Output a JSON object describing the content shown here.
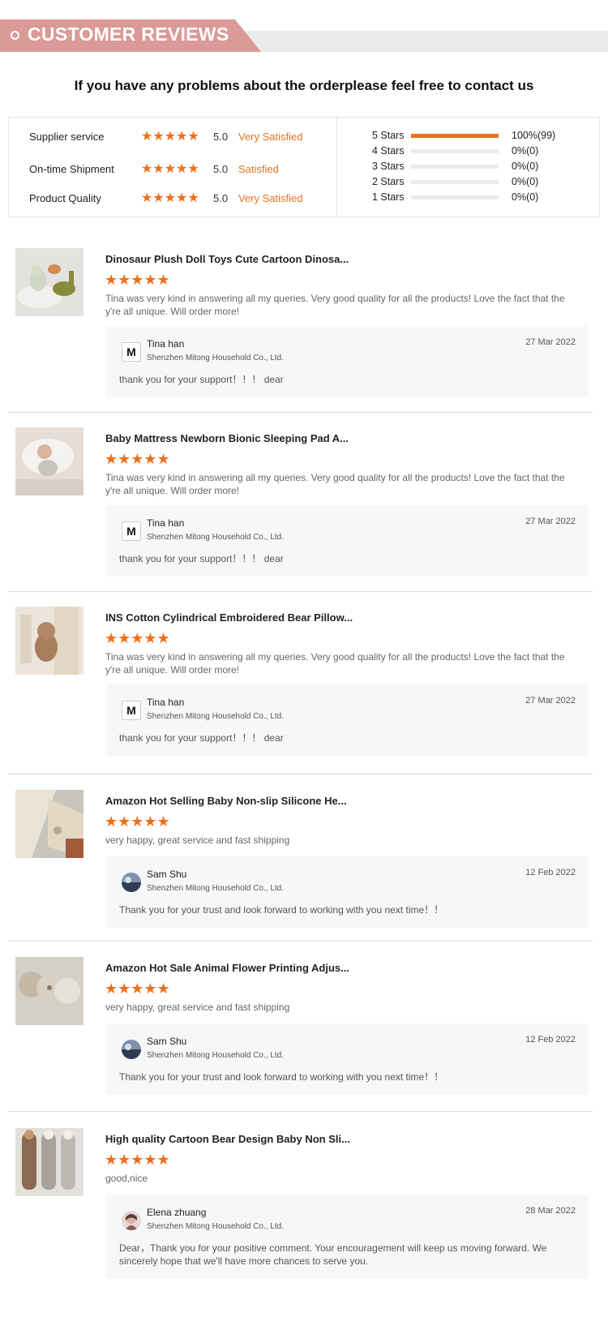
{
  "header": {
    "title": "CUSTOMER REVIEWS",
    "subtitle": "If you have any problems about the orderplease feel free to contact us"
  },
  "summary": {
    "metrics": [
      {
        "label": "Supplier service",
        "rating": 5,
        "score": "5.0",
        "text": "Very Satisfied"
      },
      {
        "label": "On-time Shipment",
        "rating": 5,
        "score": "5.0",
        "text": "Satisfied"
      },
      {
        "label": "Product Quality",
        "rating": 5,
        "score": "5.0",
        "text": "Very Satisfied"
      }
    ],
    "distribution": [
      {
        "label": "5 Stars",
        "percent": 100,
        "value": "100%(99)"
      },
      {
        "label": "4 Stars",
        "percent": 0,
        "value": "0%(0)"
      },
      {
        "label": "3 Stars",
        "percent": 0,
        "value": "0%(0)"
      },
      {
        "label": "2 Stars",
        "percent": 0,
        "value": "0%(0)"
      },
      {
        "label": "1 Stars",
        "percent": 0,
        "value": "0%(0)"
      }
    ]
  },
  "reviews": [
    {
      "product": "Dinosaur Plush Doll Toys Cute Cartoon Dinosa...",
      "rating": 5,
      "comment": "Tina was very kind in answering all my queries. Very good quality for all the products! Love the fact that the y're all unique. Will order more!",
      "reply": {
        "name": "Tina han",
        "company": "Shenzhen Mitong Household Co., Ltd.",
        "date": "27 Mar 2022",
        "text": "thank you for your support！！！ dear",
        "avatar": "M"
      }
    },
    {
      "product": "Baby Mattress Newborn Bionic Sleeping Pad A...",
      "rating": 5,
      "comment": "Tina was very kind in answering all my queries. Very good quality for all the products! Love the fact that the y're all unique. Will order more!",
      "reply": {
        "name": "Tina han",
        "company": "Shenzhen Mitong Household Co., Ltd.",
        "date": "27 Mar 2022",
        "text": "thank you for your support！！！ dear",
        "avatar": "M"
      }
    },
    {
      "product": "INS Cotton Cylindrical Embroidered Bear Pillow...",
      "rating": 5,
      "comment": "Tina was very kind in answering all my queries. Very good quality for all the products! Love the fact that the y're all unique. Will order more!",
      "reply": {
        "name": "Tina han",
        "company": "Shenzhen Mitong Household Co., Ltd.",
        "date": "27 Mar 2022",
        "text": "thank you for your support！！！ dear",
        "avatar": "M"
      }
    },
    {
      "product": "Amazon Hot Selling Baby Non-slip Silicone He...",
      "rating": 5,
      "comment": "very happy, great service and fast shipping",
      "reply": {
        "name": "Sam Shu",
        "company": "Shenzhen Mitong Household Co., Ltd.",
        "date": "12 Feb 2022",
        "text": "Thank you for your trust and look forward to working with you next time！！",
        "avatar": ""
      }
    },
    {
      "product": "Amazon Hot Sale Animal Flower Printing Adjus...",
      "rating": 5,
      "comment": "very happy, great service and fast shipping",
      "reply": {
        "name": "Sam Shu",
        "company": "Shenzhen Mitong Household Co., Ltd.",
        "date": "12 Feb 2022",
        "text": "Thank you for your trust and look forward to working with you next time！！",
        "avatar": ""
      }
    },
    {
      "product": "High quality Cartoon Bear Design Baby Non Sli...",
      "rating": 5,
      "comment": "good,nice",
      "reply": {
        "name": "Elena zhuang",
        "company": "Shenzhen Mitong Household Co., Ltd.",
        "date": "28 Mar 2022",
        "text": "Dear，Thank you for your positive comment. Your encouragement will keep us moving forward. We sincerely hope that we'll have more chances to serve you.",
        "avatar": ""
      }
    }
  ]
}
